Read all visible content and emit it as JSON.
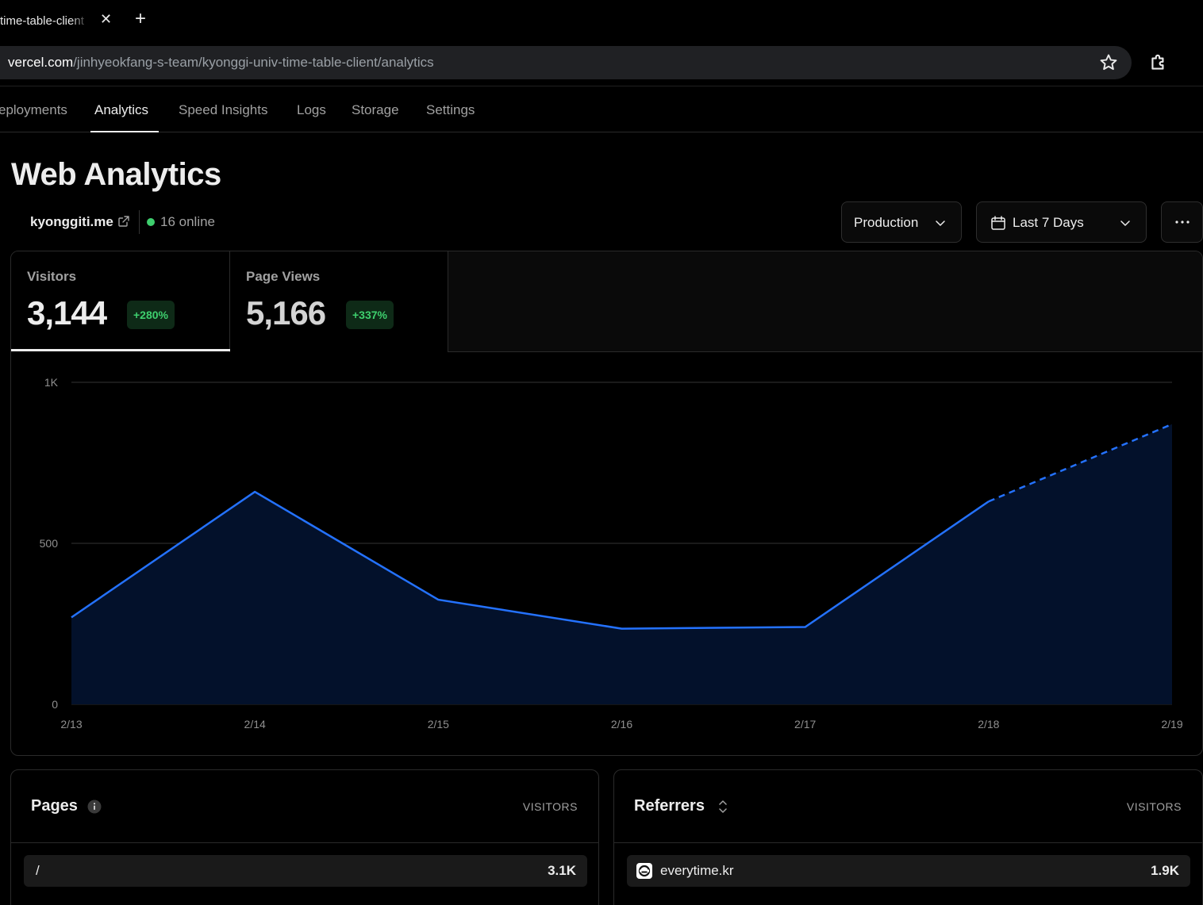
{
  "browser": {
    "tab_title": "time-table-client",
    "url_host": "vercel.com",
    "url_path": "/jinhyeokfang-s-team/kyonggi-univ-time-table-client/analytics"
  },
  "nav": {
    "items": [
      {
        "label": "eployments"
      },
      {
        "label": "Analytics"
      },
      {
        "label": "Speed Insights"
      },
      {
        "label": "Logs"
      },
      {
        "label": "Storage"
      },
      {
        "label": "Settings"
      }
    ]
  },
  "header": {
    "title": "Web Analytics",
    "domain": "kyonggiti.me",
    "online": "16 online",
    "online_color": "#3ecf6e"
  },
  "controls": {
    "environment": "Production",
    "range": "Last 7 Days"
  },
  "metrics": {
    "visitors": {
      "label": "Visitors",
      "value": "3,144",
      "change": "+280%"
    },
    "pageviews": {
      "label": "Page Views",
      "value": "5,166",
      "change": "+337%"
    }
  },
  "chart_data": {
    "type": "area",
    "x": [
      "2/13",
      "2/14",
      "2/15",
      "2/16",
      "2/17",
      "2/18",
      "2/19"
    ],
    "series": [
      {
        "values": [
          270,
          660,
          325,
          235,
          240,
          630,
          870
        ]
      }
    ],
    "y_ticks": [
      "0",
      "500",
      "1K"
    ],
    "ylim": [
      0,
      1000
    ],
    "grid": true,
    "projected_from_index": 5,
    "line_color": "#2472ff",
    "fill_color": "#03112b"
  },
  "pages_panel": {
    "title": "Pages",
    "column": "VISITORS",
    "rows": [
      {
        "label": "/",
        "value": "3.1K"
      }
    ]
  },
  "referrers_panel": {
    "title": "Referrers",
    "column": "VISITORS",
    "rows": [
      {
        "label": "everytime.kr",
        "value": "1.9K"
      }
    ]
  }
}
